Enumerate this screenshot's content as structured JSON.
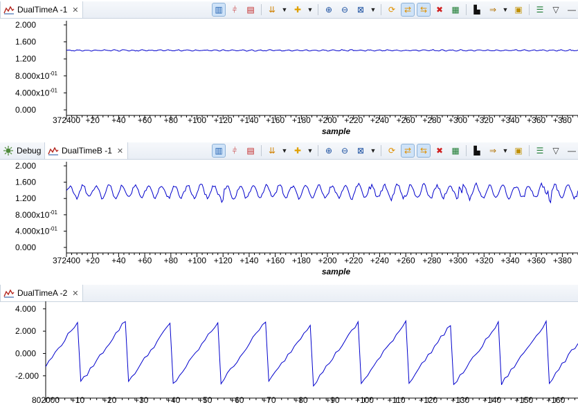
{
  "panels": [
    {
      "tabs": [
        {
          "label": "DualTimeA -1",
          "icon": "chart-icon",
          "active": true
        }
      ],
      "chart_data": {
        "type": "line",
        "ylim": [
          0,
          2
        ],
        "ytick_labels": [
          "2.000",
          "1.600",
          "1.200",
          "8.000x10-01",
          "4.000x10-01",
          "0.000"
        ],
        "ytick_values": [
          2.0,
          1.6,
          1.2,
          0.8,
          0.4,
          0.0
        ],
        "x_start": 372400,
        "xlim": [
          372400,
          372792
        ],
        "xtick_labels": [
          "372400",
          "+20",
          "+40",
          "+60",
          "+80",
          "+100",
          "+120",
          "+140",
          "+160",
          "+180",
          "+200",
          "+220",
          "+240",
          "+260",
          "+280",
          "+300",
          "+320",
          "+340",
          "+360",
          "+380"
        ],
        "xlabel": "sample",
        "series": [
          {
            "color": "#0000cc",
            "base": 1.4,
            "amp": 0.012,
            "freq": 0.9,
            "noise": 0.008,
            "points": 393
          }
        ]
      }
    },
    {
      "tabs": [
        {
          "label": "Debug",
          "icon": "debug-icon",
          "active": false
        },
        {
          "label": "DualTimeB -1",
          "icon": "chart-icon",
          "active": true
        }
      ],
      "chart_data": {
        "type": "line",
        "ylim": [
          0,
          2
        ],
        "ytick_labels": [
          "2.000",
          "1.600",
          "1.200",
          "8.000x10-01",
          "4.000x10-01",
          "0.000"
        ],
        "ytick_values": [
          2.0,
          1.6,
          1.2,
          0.8,
          0.4,
          0.0
        ],
        "x_start": 372400,
        "xlim": [
          372400,
          372792
        ],
        "xtick_labels": [
          "372400",
          "+20",
          "+40",
          "+60",
          "+80",
          "+100",
          "+120",
          "+140",
          "+160",
          "+180",
          "+200",
          "+220",
          "+240",
          "+260",
          "+280",
          "+300",
          "+320",
          "+340",
          "+360",
          "+380"
        ],
        "xlabel": "sample",
        "series": [
          {
            "color": "#0000cc",
            "base": 1.37,
            "amp": 0.15,
            "freq": 0.625,
            "noise": 0.04,
            "points": 393
          }
        ]
      }
    },
    {
      "tabs": [
        {
          "label": "DualTimeA -2",
          "icon": "chart-icon",
          "active": true
        }
      ],
      "chart_data": {
        "type": "line",
        "ylim": [
          -3.5,
          4.3
        ],
        "ytick_labels": [
          "4.000",
          "2.000",
          "0.000",
          "-2.000"
        ],
        "ytick_values": [
          4.0,
          2.0,
          0.0,
          -2.0
        ],
        "x_start": 802000,
        "xlim": [
          802000,
          802167
        ],
        "xtick_labels": [
          "802000",
          "+10",
          "+20",
          "+30",
          "+40",
          "+50",
          "+60",
          "+70",
          "+80",
          "+90",
          "+100",
          "+110",
          "+120",
          "+130",
          "+140",
          "+150",
          "+160"
        ],
        "xlabel": "",
        "series": [
          {
            "color": "#0000cc",
            "sawtooth": true,
            "period": 14.7,
            "phase": 4.3,
            "min": -2.85,
            "max": 3.0,
            "noise": 0.08,
            "points": 168
          }
        ]
      }
    }
  ],
  "toolbar": {
    "icons": [
      "fit-horizontal-icon",
      "fit-vertical-icon",
      "fit-all-icon",
      "marker-icon",
      "dropdown-arrow",
      "add-plot-icon",
      "dropdown-arrow",
      "zoom-in-icon",
      "zoom-out-icon",
      "zoom-fit-icon",
      "dropdown-arrow",
      "refresh-icon",
      "sync-icon",
      "sync-time-icon",
      "delete-icon",
      "export-icon",
      "pin-icon",
      "arrow-menu-icon",
      "dropdown-arrow",
      "lock-icon",
      "properties-icon",
      "view-menu-icon",
      "minimize-icon"
    ]
  }
}
